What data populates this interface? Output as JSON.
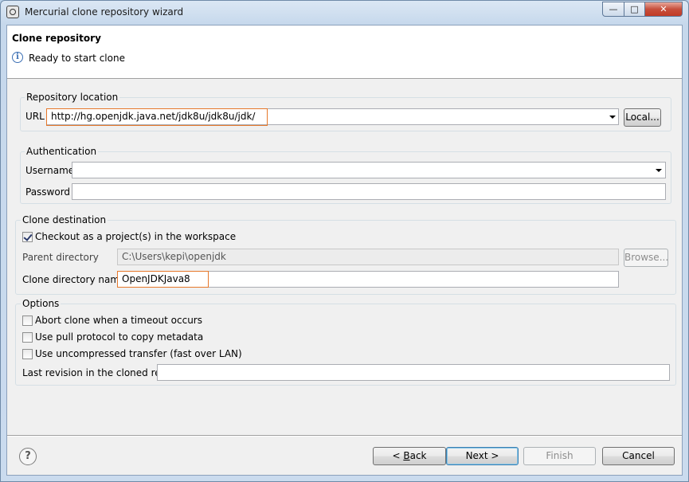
{
  "window": {
    "title": "Mercurial clone repository wizard",
    "controls": {
      "minimize": "—",
      "maximize": "□",
      "close": "✕"
    }
  },
  "header": {
    "title": "Clone repository",
    "message": "Ready to start clone",
    "icon": "info-icon"
  },
  "repository_location": {
    "group_label": "Repository location",
    "url_label": "URL",
    "url_value": "http://hg.openjdk.java.net/jdk8u/jdk8u/jdk/",
    "local_button": "Local..."
  },
  "authentication": {
    "group_label": "Authentication",
    "username_label": "Username",
    "username_value": "",
    "password_label": "Password",
    "password_value": ""
  },
  "clone_destination": {
    "group_label": "Clone destination",
    "checkout_label": "Checkout as a project(s) in the workspace",
    "checkout_checked": true,
    "parent_dir_label": "Parent directory",
    "parent_dir_value": "C:\\Users\\kepi\\openjdk",
    "browse_button": "Browse...",
    "clone_dir_label": "Clone directory name",
    "clone_dir_value": "OpenJDKJava8"
  },
  "options": {
    "group_label": "Options",
    "abort_label": "Abort clone when a timeout occurs",
    "pull_label": "Use pull protocol to copy metadata",
    "uncompressed_label": "Use uncompressed transfer (fast over LAN)",
    "last_revision_label": "Last revision in the cloned repo",
    "last_revision_value": ""
  },
  "footer": {
    "help_icon": "?",
    "back_pre": "< ",
    "back_key": "B",
    "back_post": "ack",
    "next": "Next >",
    "finish": "Finish",
    "cancel": "Cancel"
  },
  "colors": {
    "highlight": "#e6782b",
    "header_bg": "#ffffff",
    "dialog_bg": "#f0f0f0"
  }
}
